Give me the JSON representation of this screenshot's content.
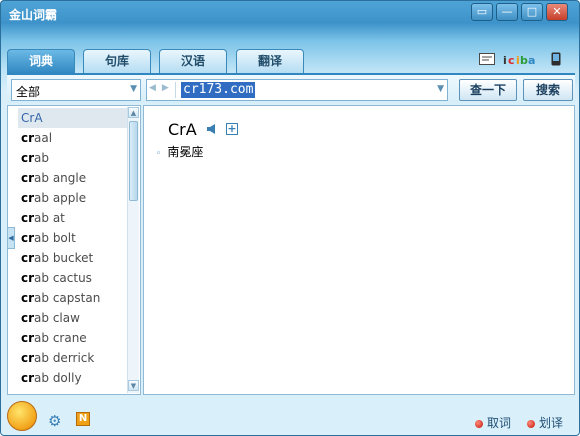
{
  "window": {
    "title": "金山词霸"
  },
  "tabs": [
    {
      "label": "词典"
    },
    {
      "label": "句库"
    },
    {
      "label": "汉语"
    },
    {
      "label": "翻译"
    }
  ],
  "search": {
    "category": "全部",
    "query": "cr173.com",
    "lookup_label": "查一下",
    "search_label": "搜索"
  },
  "wordlist": {
    "items": [
      {
        "bold": "",
        "rest": "CrA"
      },
      {
        "bold": "cr",
        "rest": "aal"
      },
      {
        "bold": "cr",
        "rest": "ab"
      },
      {
        "bold": "cr",
        "rest": "ab angle"
      },
      {
        "bold": "cr",
        "rest": "ab apple"
      },
      {
        "bold": "cr",
        "rest": "ab at"
      },
      {
        "bold": "cr",
        "rest": "ab bolt"
      },
      {
        "bold": "cr",
        "rest": "ab bucket"
      },
      {
        "bold": "cr",
        "rest": "ab cactus"
      },
      {
        "bold": "cr",
        "rest": "ab capstan"
      },
      {
        "bold": "cr",
        "rest": "ab claw"
      },
      {
        "bold": "cr",
        "rest": "ab crane"
      },
      {
        "bold": "cr",
        "rest": "ab derrick"
      },
      {
        "bold": "cr",
        "rest": "ab dolly"
      }
    ]
  },
  "entry": {
    "headword": "CrA",
    "definition": "南冕座"
  },
  "bottom": {
    "cancel_label": "取词",
    "select_label": "划译"
  },
  "icons": {
    "app_logo": "app-logo-icon",
    "settings": "gear-icon",
    "notes": "n-icon"
  },
  "colors": {
    "accent": "#2f86c0",
    "selection": "#2f6cc2"
  }
}
